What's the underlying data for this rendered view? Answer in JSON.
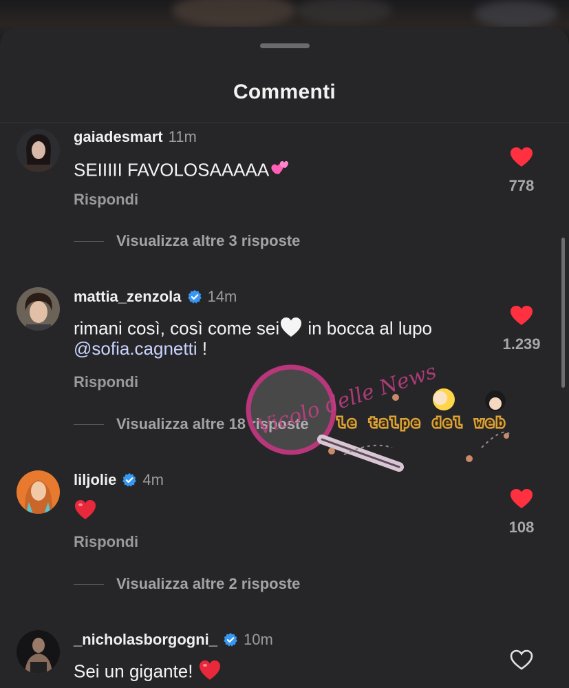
{
  "header": {
    "title": "Commenti"
  },
  "comments": [
    {
      "username": "gaiadesmart",
      "verified": false,
      "time": "11m",
      "text": "SEIIIII FAVOLOSAAAAA",
      "emoji": "two-hearts",
      "reply_label": "Rispondi",
      "more_replies": "Visualizza altre 3 risposte",
      "likes": "778",
      "liked": true
    },
    {
      "username": "mattia_zenzola",
      "verified": true,
      "time": "14m",
      "text_line1": "rimani così, così come sei",
      "text_line1b": " in bocca al lupo",
      "mention": "@sofia.cagnetti",
      "text_line2_end": " !",
      "emoji": "white-heart",
      "reply_label": "Rispondi",
      "more_replies": "Visualizza altre 18 risposte",
      "likes": "1.239",
      "liked": true
    },
    {
      "username": "liljolie",
      "verified": true,
      "time": "4m",
      "emoji": "red-heart",
      "reply_label": "Rispondi",
      "more_replies": "Visualizza altre 2 risposte",
      "likes": "108",
      "liked": true
    },
    {
      "username": "_nicholasborgogni_",
      "verified": true,
      "time": "10m",
      "text": "Sei un gigante! ",
      "emoji": "red-heart",
      "liked": false
    }
  ],
  "watermark": {
    "text_left": "Vicolo delle News",
    "text_right": "le talpe del web"
  },
  "colors": {
    "sheet_bg": "#262628",
    "like_red": "#ff3040",
    "verified_blue": "#3897f0"
  }
}
